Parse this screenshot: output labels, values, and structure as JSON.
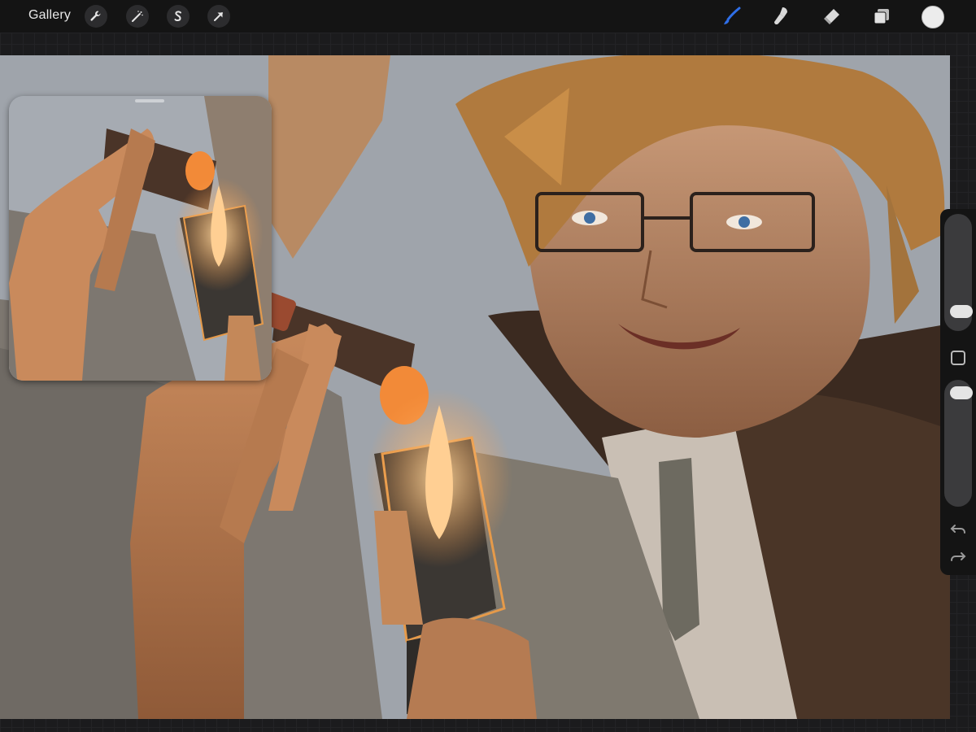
{
  "topbar": {
    "gallery_label": "Gallery",
    "left_tools": [
      "wrench-icon",
      "magic-wand-icon",
      "selection-icon",
      "transform-arrow-icon"
    ],
    "right_tools": [
      "brush-icon",
      "smudge-icon",
      "eraser-icon",
      "layers-icon"
    ],
    "active_tool": "brush-icon",
    "accent_color": "#2f6fe8",
    "current_color": "#ececec"
  },
  "sidebar": {
    "brush_size_level": 0.25,
    "opacity_level": 0.95,
    "icons": [
      "modifier-square-icon",
      "undo-icon",
      "redo-icon"
    ]
  },
  "canvas": {
    "subject": "illustration",
    "reference_window": true
  }
}
